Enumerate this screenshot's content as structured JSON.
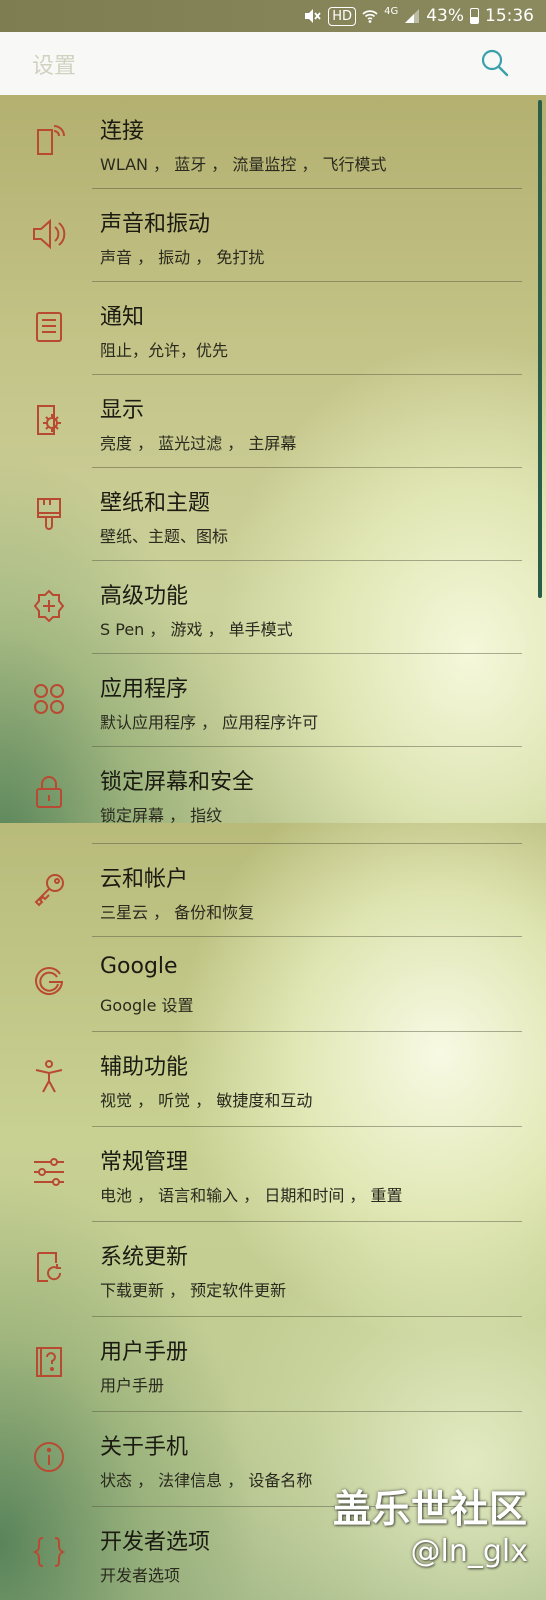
{
  "status_bar": {
    "hd": "HD",
    "network": "4G",
    "battery": "43%",
    "time": "15:36"
  },
  "header": {
    "title": "设置"
  },
  "items": [
    {
      "title": "连接",
      "subtitle": "WLAN ， 蓝牙 ， 流量监控 ， 飞行模式",
      "icon": "connections-icon"
    },
    {
      "title": "声音和振动",
      "subtitle": "声音 ， 振动 ， 免打扰",
      "icon": "sound-icon"
    },
    {
      "title": "通知",
      "subtitle": "阻止，允许，优先",
      "icon": "notification-icon"
    },
    {
      "title": "显示",
      "subtitle": "亮度 ， 蓝光过滤 ， 主屏幕",
      "icon": "display-icon"
    },
    {
      "title": "壁纸和主题",
      "subtitle": "壁纸、主题、图标",
      "icon": "brush-icon"
    },
    {
      "title": "高级功能",
      "subtitle": "S Pen ， 游戏 ， 单手模式",
      "icon": "advanced-gear-icon"
    },
    {
      "title": "应用程序",
      "subtitle": "默认应用程序 ， 应用程序许可",
      "icon": "apps-icon"
    },
    {
      "title": "锁定屏幕和安全",
      "subtitle": "锁定屏幕 ， 指纹",
      "icon": "lock-icon"
    },
    {
      "title": "云和帐户",
      "subtitle": "三星云 ， 备份和恢复",
      "icon": "key-icon"
    },
    {
      "title": "Google",
      "subtitle": "Google 设置",
      "icon": "google-icon"
    },
    {
      "title": "辅助功能",
      "subtitle": "视觉 ， 听觉 ， 敏捷度和互动",
      "icon": "accessibility-icon"
    },
    {
      "title": "常规管理",
      "subtitle": "电池 ， 语言和输入 ， 日期和时间 ， 重置",
      "icon": "sliders-icon"
    },
    {
      "title": "系统更新",
      "subtitle": "下载更新 ， 预定软件更新",
      "icon": "update-icon"
    },
    {
      "title": "用户手册",
      "subtitle": "用户手册",
      "icon": "manual-icon"
    },
    {
      "title": "关于手机",
      "subtitle": "状态 ， 法律信息 ， 设备名称",
      "icon": "info-icon"
    },
    {
      "title": "开发者选项",
      "subtitle": "开发者选项",
      "icon": "braces-icon"
    }
  ],
  "watermark": {
    "line1": "盖乐世社区",
    "line2": "@ln_glx"
  },
  "colors": {
    "icon": "#b94a32",
    "accent": "#3aa0a8",
    "scrollbar": "#2b5e4a"
  }
}
